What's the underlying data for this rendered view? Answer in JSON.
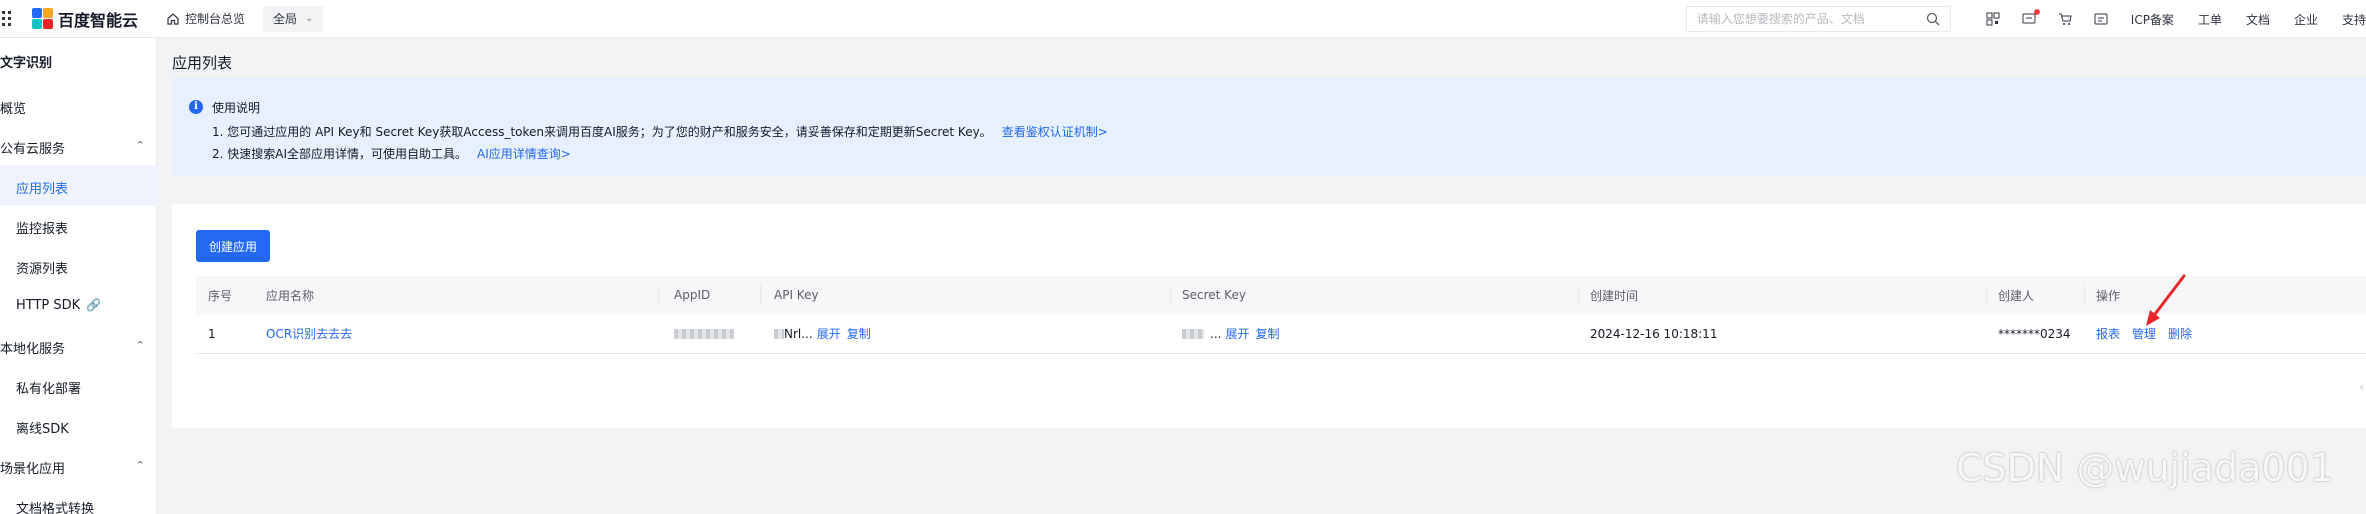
{
  "topbar": {
    "logo_text": "百度智能云",
    "console_label": "控制台总览",
    "region_label": "全局",
    "search_placeholder": "请输入您想要搜索的产品、文档",
    "links": [
      "ICP备案",
      "工单",
      "文档",
      "企业",
      "支持"
    ]
  },
  "sidebar": {
    "title": "文字识别",
    "overview": "概览",
    "groups": [
      {
        "label": "公有云服务",
        "items": [
          "应用列表",
          "监控报表",
          "资源列表",
          "HTTP SDK"
        ]
      },
      {
        "label": "本地化服务",
        "items": [
          "私有化部署",
          "离线SDK"
        ]
      },
      {
        "label": "场景化应用",
        "items": [
          "文档格式转换"
        ]
      }
    ],
    "active_item": "应用列表"
  },
  "main": {
    "page_title": "应用列表",
    "notice": {
      "heading": "使用说明",
      "line1": "1. 您可通过应用的 API Key和 Secret Key获取Access_token来调用百度AI服务；为了您的财产和服务安全，请妥善保存和定期更新Secret Key。",
      "line1_link": "查看鉴权认证机制>",
      "line2": "2. 快速搜索AI全部应用详情，可使用自助工具。",
      "line2_link": "AI应用详情查询>"
    },
    "create_button": "创建应用",
    "table": {
      "headers": [
        "序号",
        "应用名称",
        "AppID",
        "API Key",
        "Secret Key",
        "创建时间",
        "创建人",
        "操作"
      ],
      "rows": [
        {
          "index": "1",
          "name": "OCR识别去去去",
          "api_key_suffix": "Nrl...",
          "secret_key_suffix": "...",
          "expand": "展开",
          "copy": "复制",
          "created_at": "2024-12-16 10:18:11",
          "creator": "*******0234",
          "actions": [
            "报表",
            "管理",
            "删除"
          ]
        }
      ]
    }
  },
  "watermark": "CSDN @wujiada001",
  "colors": {
    "primary": "#2468f2",
    "annotation_arrow": "#e8262a"
  }
}
